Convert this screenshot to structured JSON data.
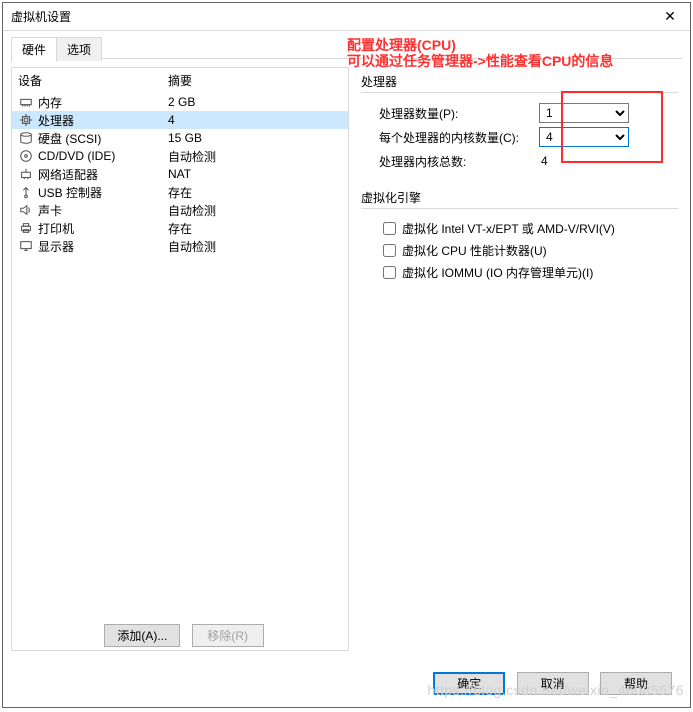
{
  "window": {
    "title": "虚拟机设置"
  },
  "tabs": {
    "hardware": "硬件",
    "options": "选项"
  },
  "columns": {
    "device": "设备",
    "summary": "摘要"
  },
  "devices": [
    {
      "id": "memory",
      "name": "内存",
      "summary": "2 GB"
    },
    {
      "id": "cpu",
      "name": "处理器",
      "summary": "4"
    },
    {
      "id": "hdd",
      "name": "硬盘 (SCSI)",
      "summary": "15 GB"
    },
    {
      "id": "cd",
      "name": "CD/DVD (IDE)",
      "summary": "自动检测"
    },
    {
      "id": "net",
      "name": "网络适配器",
      "summary": "NAT"
    },
    {
      "id": "usb",
      "name": "USB 控制器",
      "summary": "存在"
    },
    {
      "id": "sound",
      "name": "声卡",
      "summary": "自动检测"
    },
    {
      "id": "printer",
      "name": "打印机",
      "summary": "存在"
    },
    {
      "id": "display",
      "name": "显示器",
      "summary": "自动检测"
    }
  ],
  "buttons": {
    "add": "添加(A)...",
    "remove": "移除(R)",
    "ok": "确定",
    "cancel": "取消",
    "help": "帮助"
  },
  "annotation": {
    "line1": "配置处理器(CPU)",
    "line2": "可以通过任务管理器->性能查看CPU的信息"
  },
  "proc_group": {
    "title": "处理器",
    "count_label": "处理器数量(P):",
    "count_value": "1",
    "cores_label": "每个处理器的内核数量(C):",
    "cores_value": "4",
    "total_label": "处理器内核总数:",
    "total_value": "4"
  },
  "virt_group": {
    "title": "虚拟化引擎",
    "opt1": "虚拟化 Intel VT-x/EPT 或 AMD-V/RVI(V)",
    "opt2": "虚拟化 CPU 性能计数器(U)",
    "opt3": "虚拟化 IOMMU (IO 内存管理单元)(I)"
  },
  "watermark": "https://blog.csdn.net/weixin_46085576"
}
